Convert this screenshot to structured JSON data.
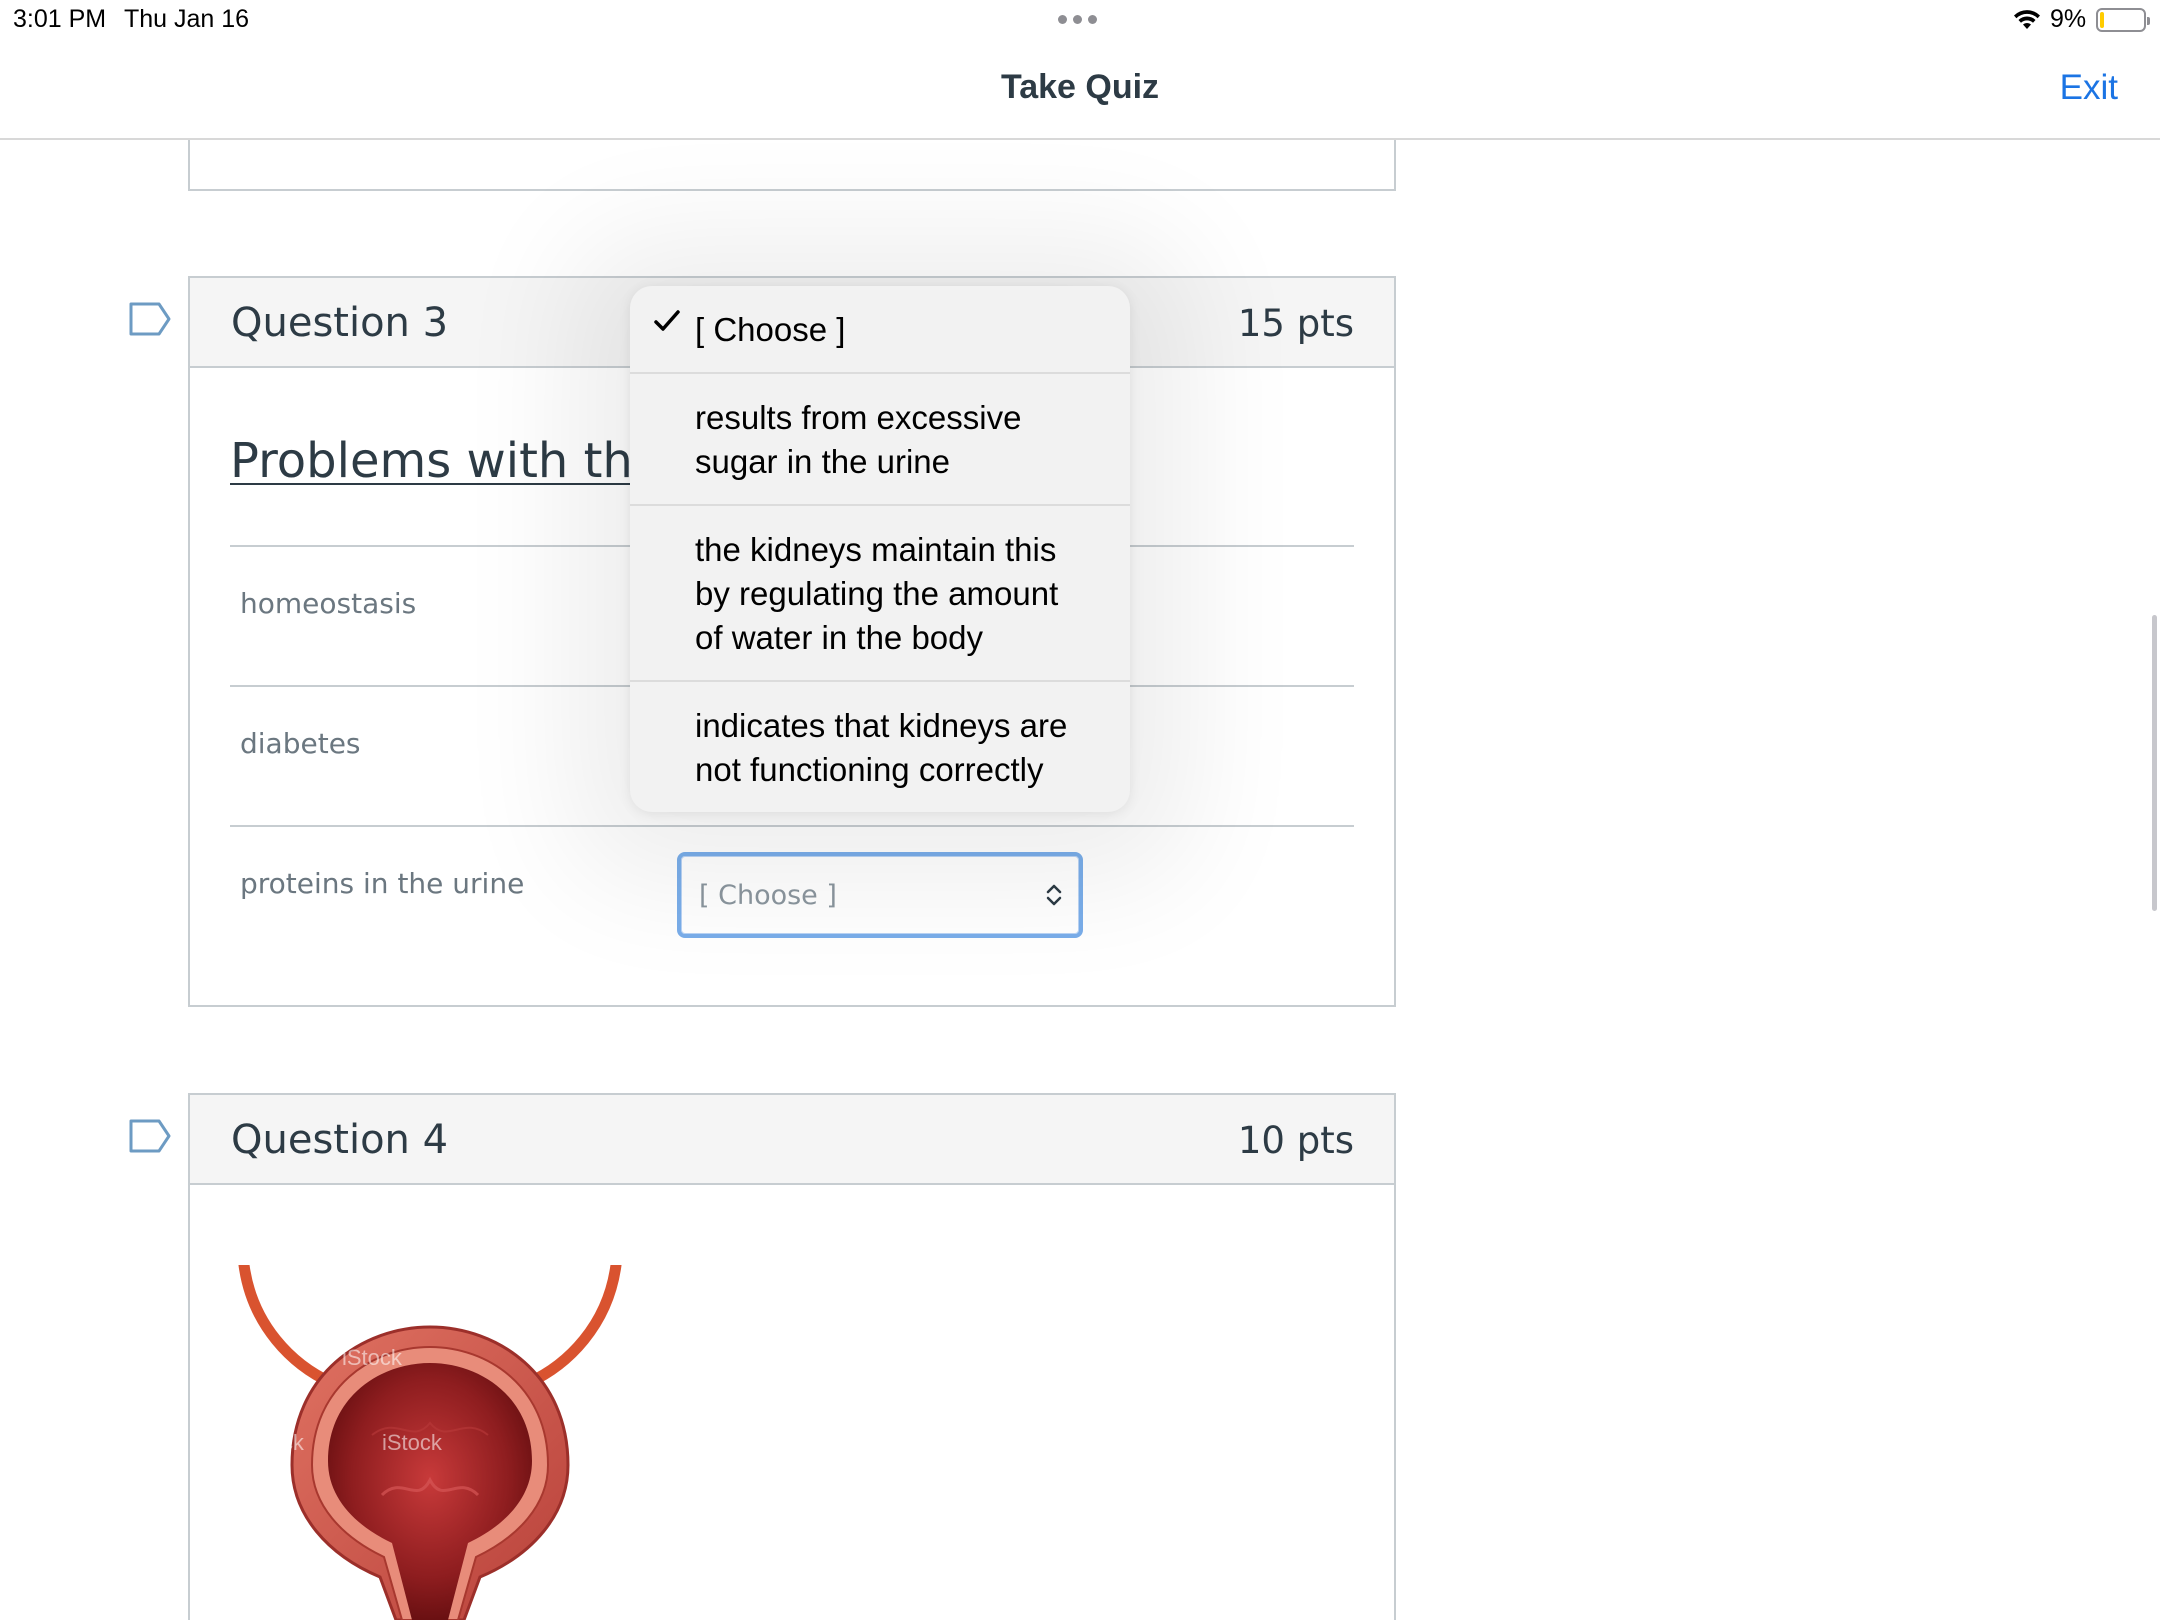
{
  "status_bar": {
    "time": "3:01 PM",
    "date": "Thu Jan 16",
    "battery": "9%",
    "battery_level": 0.09
  },
  "nav": {
    "title": "Take Quiz",
    "exit_label": "Exit"
  },
  "question3": {
    "title": "Question 3",
    "points": "15 pts",
    "heading": "Problems with the",
    "rows": [
      {
        "label": "homeostasis"
      },
      {
        "label": "diabetes"
      },
      {
        "label": "proteins in the urine",
        "select_value": "[ Choose ]"
      }
    ]
  },
  "dropdown": {
    "options": [
      {
        "lines": [
          "[ Choose ]"
        ],
        "selected": true
      },
      {
        "lines": [
          "results from excessive",
          "sugar in the urine"
        ],
        "selected": false
      },
      {
        "lines": [
          "the kidneys maintain this",
          "by regulating the amount",
          "of water in the body"
        ],
        "selected": false
      },
      {
        "lines": [
          "indicates that kidneys are",
          "not functioning correctly"
        ],
        "selected": false
      }
    ]
  },
  "question4": {
    "title": "Question 4",
    "points": "10 pts",
    "image_watermark": "iStock"
  },
  "colors": {
    "accent": "#1b74e4",
    "text": "#2d3b45",
    "border": "#c7cdd1",
    "select_focus": "#7aaeea",
    "flag": "#6d9bc3"
  }
}
